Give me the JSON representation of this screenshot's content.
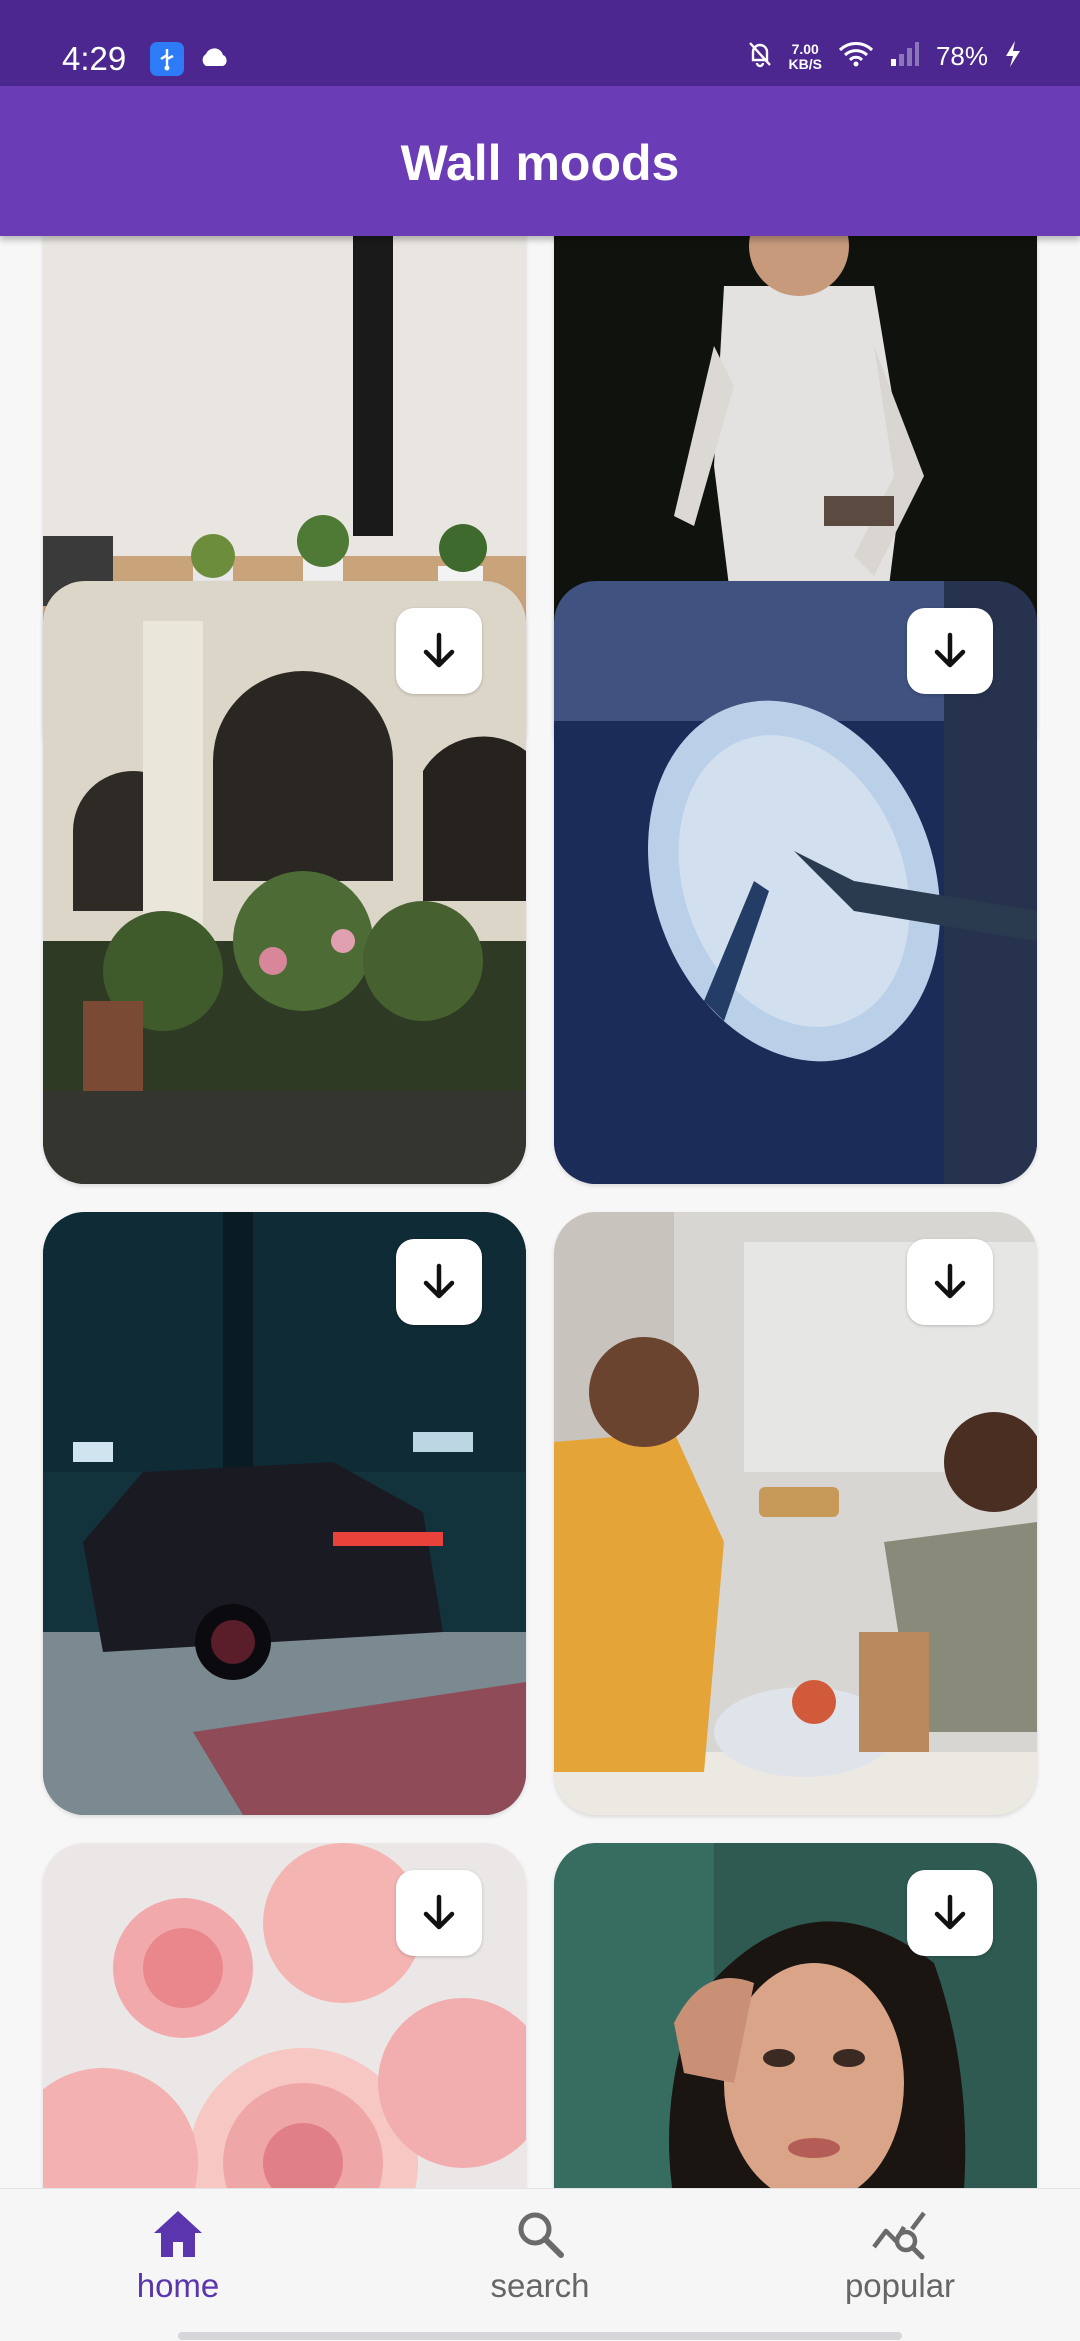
{
  "status_bar": {
    "time": "4:29",
    "net_speed_value": "7.00",
    "net_speed_unit": "KB/S",
    "battery": "78%"
  },
  "app": {
    "title": "Wall moods"
  },
  "grid": {
    "cards": [
      {
        "id": "c1",
        "subject": "desk-workspace",
        "has_download": false
      },
      {
        "id": "c2",
        "subject": "man-white-shirt",
        "has_download": false
      },
      {
        "id": "c3",
        "subject": "courtyard-plants",
        "has_download": true
      },
      {
        "id": "c4",
        "subject": "mirror-hands",
        "has_download": true
      },
      {
        "id": "c5",
        "subject": "car-garage",
        "has_download": true
      },
      {
        "id": "c6",
        "subject": "kitchen-couple",
        "has_download": true
      },
      {
        "id": "c7",
        "subject": "paper-fans",
        "has_download": true
      },
      {
        "id": "c8",
        "subject": "woman-portrait",
        "has_download": true
      }
    ]
  },
  "bottom_nav": {
    "items": [
      {
        "label": "home",
        "icon": "home-icon",
        "active": true
      },
      {
        "label": "search",
        "icon": "search-icon",
        "active": false
      },
      {
        "label": "popular",
        "icon": "trending-icon",
        "active": false
      }
    ]
  },
  "colors": {
    "status_bar": "#4b278f",
    "app_bar": "#6a3db6",
    "accent": "#5b35ad"
  }
}
